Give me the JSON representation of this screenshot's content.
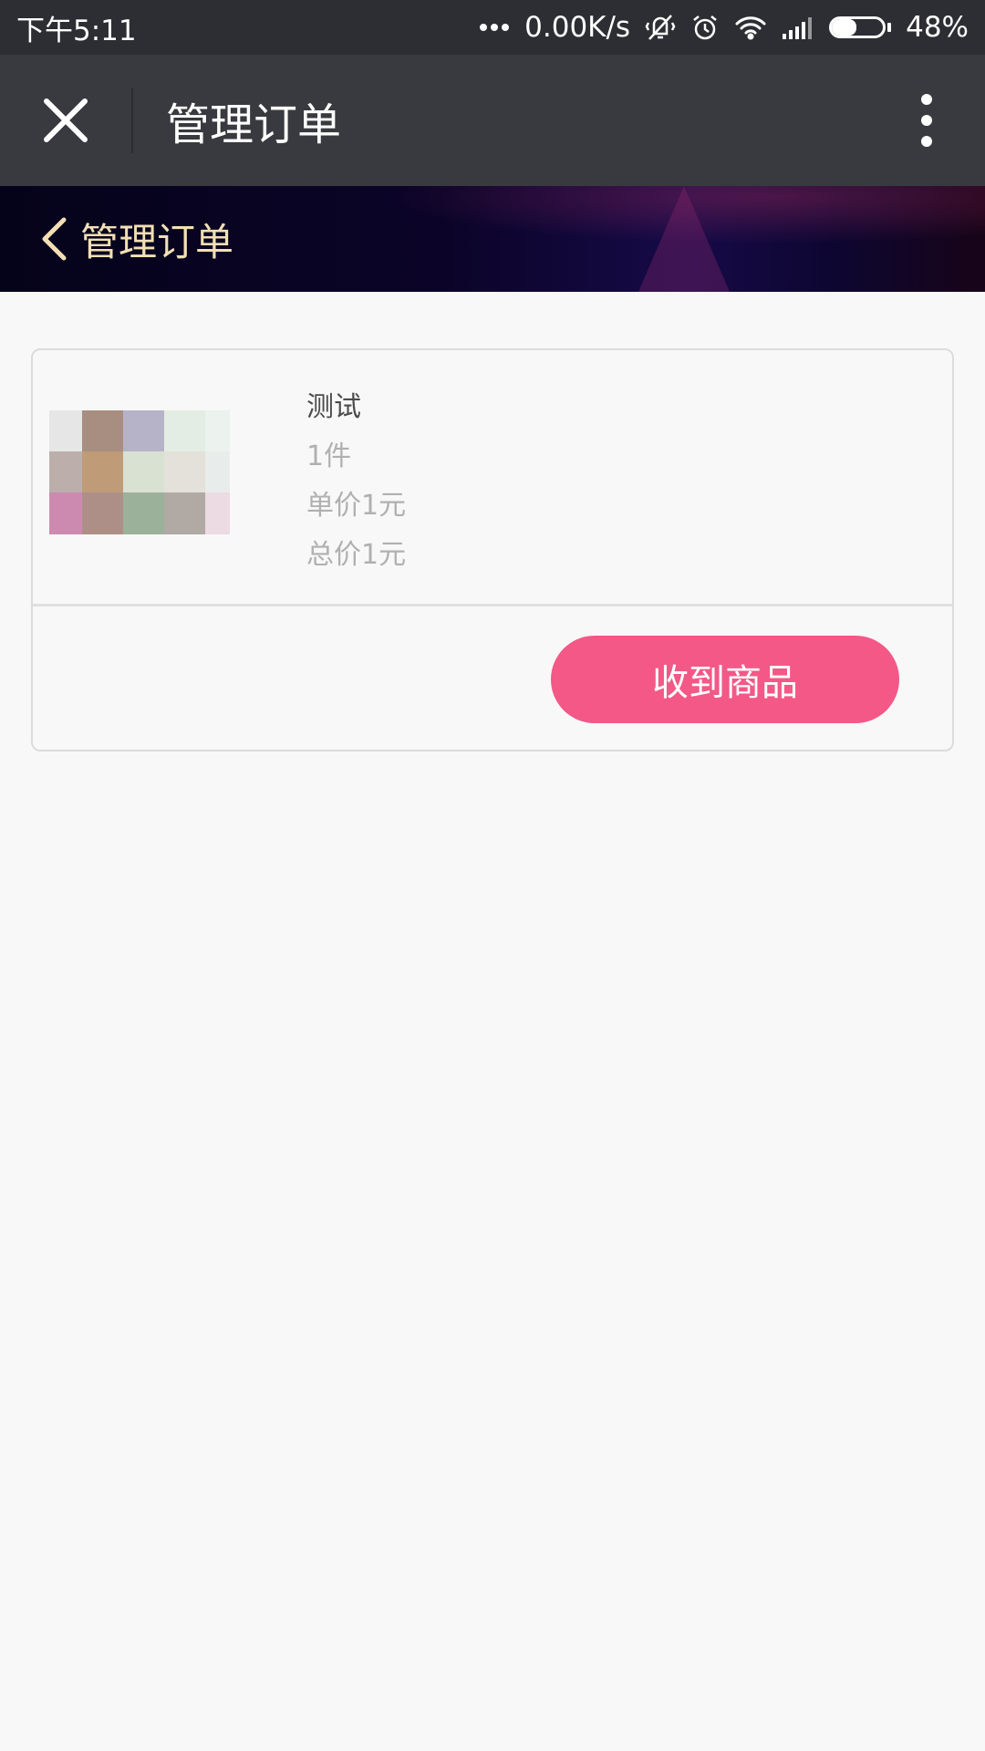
{
  "status_bar": {
    "time": "下午5:11",
    "net_speed": "0.00K/s",
    "battery_percent": "48%",
    "battery_level": 0.48,
    "icons": [
      "more-dots-icon",
      "vibrate-off-icon",
      "alarm-icon",
      "wifi-icon",
      "signal-icon",
      "battery-icon"
    ]
  },
  "title_bar": {
    "title": "管理订单",
    "close_icon": "close-icon",
    "more_icon": "more-vertical-icon"
  },
  "page_header": {
    "back_icon": "chevron-left-icon",
    "title": "管理订单"
  },
  "order": {
    "item_name": "测试",
    "quantity": "1件",
    "unit_price": "单价1元",
    "total_price": "总价1元",
    "action_label": "收到商品",
    "thumbnail_colors": [
      "#e6e6e6",
      "#a88e81",
      "#b6b3c8",
      "#e3ede4",
      "#ecf2ee",
      "#bcafab",
      "#bf9b77",
      "#d9e1d3",
      "#e3e1da",
      "#e8ecea",
      "#cd8ab0",
      "#ad8f87",
      "#9cb19a",
      "#b0a9a4",
      "#ecdbe2"
    ]
  },
  "colors": {
    "status_bar_bg": "#2d2e33",
    "title_bar_bg": "#393a3f",
    "page_bg": "#f8f8f8",
    "header_text": "#f3dfb4",
    "accent_button": "#f35887"
  }
}
